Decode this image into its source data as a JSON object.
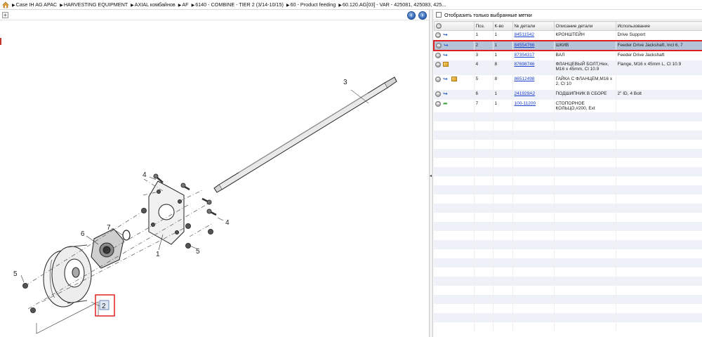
{
  "breadcrumb": [
    "Case IH AG APAC",
    "HARVESTING EQUIPMENT",
    "AXIAL комбайнов",
    "AF",
    "6140 - COMBINE - TIER 2 (3/14-10/15)",
    "60 - Product feeding",
    "60.120.AG[03] - VAR - 425081, 425083, 425..."
  ],
  "toolbar": {
    "expand_glyph": "+",
    "prev_glyph": "‹",
    "next_glyph": "›"
  },
  "splitter": {
    "glyph": "◂"
  },
  "filter": {
    "label": "Отобразить только выбранные метки"
  },
  "table": {
    "headers": [
      "",
      "Поз.",
      "К-во",
      "№ детали",
      "Описание детали",
      "Использование"
    ],
    "rows": [
      {
        "pos": "1",
        "qty": "1",
        "part": "84511542",
        "desc": "КРОНШТЕЙН",
        "usage": "Drive Support",
        "icons": [
          "blue-arrow"
        ],
        "selected": false
      },
      {
        "pos": "2",
        "qty": "1",
        "part": "84554766",
        "desc": "ШКИВ",
        "usage": "Feeder Drive Jackshaft, Incl 6, 7",
        "icons": [
          "blue-arrow"
        ],
        "selected": true
      },
      {
        "pos": "3",
        "qty": "1",
        "part": "87354317",
        "desc": "ВАЛ",
        "usage": "Feeder Drive Jackshaft",
        "icons": [
          "blue-arrow"
        ],
        "selected": false
      },
      {
        "pos": "4",
        "qty": "8",
        "part": "87698746",
        "desc": "ФЛАНЦЕВЫЙ БОЛТ,Hex, M16 x 45mm, Cl 10.9",
        "usage": "Flange, M16 x 45mm L, Cl 10.9",
        "icons": [
          "box"
        ],
        "selected": false
      },
      {
        "pos": "5",
        "qty": "8",
        "part": "86512498",
        "desc": "ГАЙКА С ФЛАНЦЕМ,M16 x 2, Cl 10",
        "usage": "",
        "icons": [
          "blue-arrow",
          "box"
        ],
        "selected": false
      },
      {
        "pos": "6",
        "qty": "1",
        "part": "241929A2",
        "desc": "ПОДШИПНИК В СБОРЕ",
        "usage": "2\" ID, 4 Bolt",
        "icons": [
          "blue-arrow"
        ],
        "selected": false
      },
      {
        "pos": "7",
        "qty": "1",
        "part": "100-11200",
        "desc": "СТОПОРНОЕ КОЛЬЦО,#200, Ext",
        "usage": "",
        "icons": [
          "green-arrow"
        ],
        "selected": false
      }
    ]
  },
  "diagram": {
    "callouts": [
      "1",
      "2",
      "3",
      "4",
      "4",
      "5",
      "5",
      "6",
      "7"
    ],
    "highlighted_callout": "2",
    "accent_color": "#e02020"
  }
}
